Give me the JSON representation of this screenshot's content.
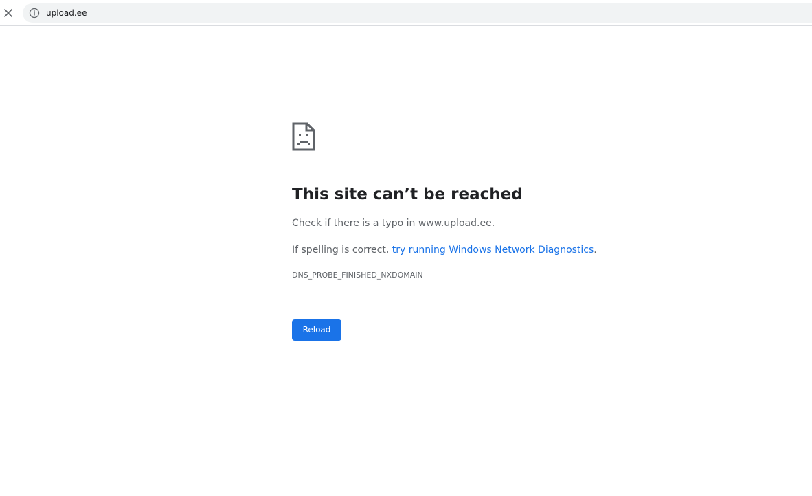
{
  "browser": {
    "stop_icon": "close-icon",
    "info_icon": "info-icon",
    "url": "upload.ee"
  },
  "error": {
    "icon": "sad-document-icon",
    "headline": "This site can’t be reached",
    "check_text": "Check if there is a typo in www.upload.ee.",
    "spelling_prefix": "If spelling is correct, ",
    "diagnostics_link": "try running Windows Network Diagnostics",
    "spelling_suffix": ".",
    "code": "DNS_PROBE_FINISHED_NXDOMAIN",
    "reload_label": "Reload"
  },
  "colors": {
    "accent": "#1a73e8",
    "body_text": "#5f6368",
    "headline_text": "#202124",
    "omnibox_bg": "#f1f3f4"
  }
}
